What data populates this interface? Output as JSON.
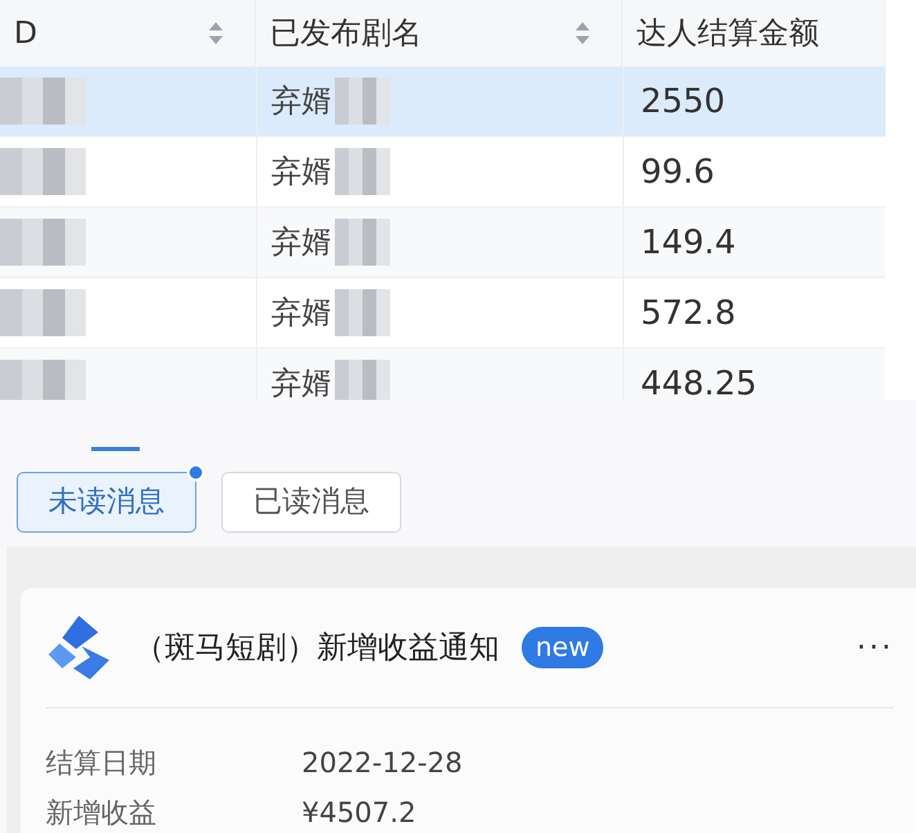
{
  "table": {
    "columns": [
      {
        "label": "D",
        "sortable": true
      },
      {
        "label": "已发布剧名",
        "sortable": true
      },
      {
        "label": "达人结算金额",
        "sortable": false
      }
    ],
    "rows": [
      {
        "drama": "弃婿",
        "amount": "2550",
        "selected": true
      },
      {
        "drama": "弃婿",
        "amount": "99.6",
        "selected": false
      },
      {
        "drama": "弃婿",
        "amount": "149.4",
        "selected": false
      },
      {
        "drama": "弃婿",
        "amount": "572.8",
        "selected": false
      },
      {
        "drama": "弃婿",
        "amount": "448.25",
        "selected": false
      }
    ]
  },
  "message_tabs": [
    {
      "label": "未读消息",
      "selected": true,
      "dot": true
    },
    {
      "label": "已读消息",
      "selected": false,
      "dot": false
    }
  ],
  "notification": {
    "title": "（斑马短剧）新增收益通知",
    "badge": "new",
    "more": "···",
    "fields": [
      {
        "label": "结算日期",
        "value": "2022-12-28"
      },
      {
        "label": "新增收益",
        "value": "¥4507.2"
      }
    ]
  }
}
